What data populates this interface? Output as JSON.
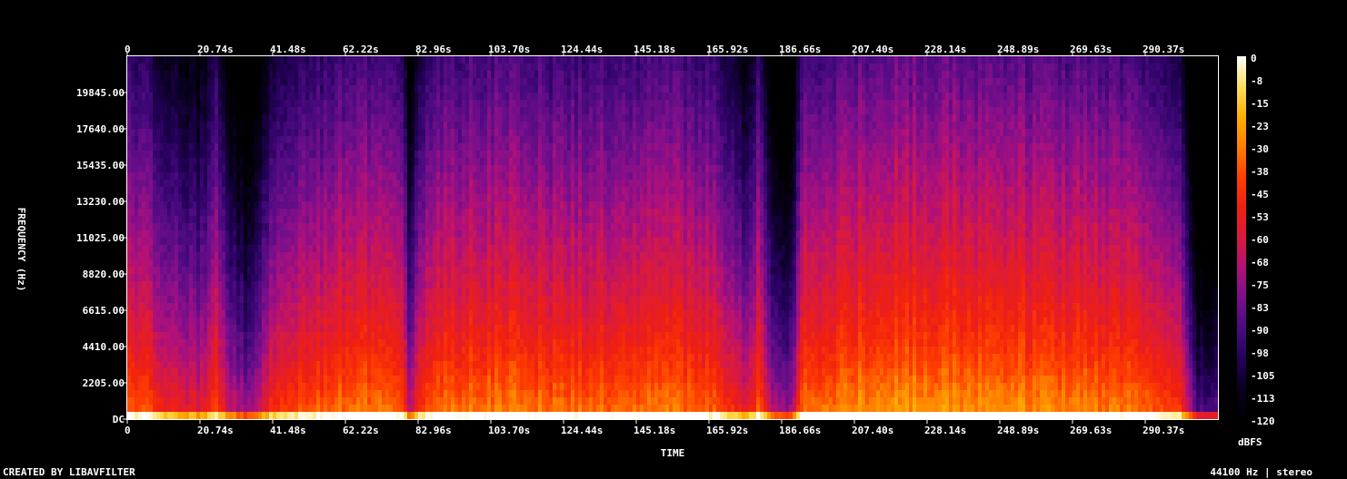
{
  "chart_data": {
    "type": "heatmap",
    "time_ticks": [
      "0",
      "20.74s",
      "41.48s",
      "62.22s",
      "82.96s",
      "103.70s",
      "124.44s",
      "145.18s",
      "165.92s",
      "186.66s",
      "207.40s",
      "228.14s",
      "248.89s",
      "269.63s",
      "290.37s"
    ],
    "freq_ticks": [
      "DC",
      "2205.00",
      "4410.00",
      "6615.00",
      "8820.00",
      "11025.00",
      "13230.00",
      "15435.00",
      "17640.00",
      "19845.00"
    ],
    "colorbar_ticks": [
      "0",
      "-8",
      "-15",
      "-23",
      "-30",
      "-38",
      "-45",
      "-53",
      "-60",
      "-68",
      "-75",
      "-83",
      "-90",
      "-98",
      "-105",
      "-113",
      "-120"
    ],
    "xlabel": "TIME",
    "ylabel": "FREQUENCY (Hz)",
    "colorbar_label": "dBFS",
    "colormap": [
      "#000000",
      "#0a0020",
      "#24005a",
      "#4a0a80",
      "#7a0f8c",
      "#b0107a",
      "#d81a40",
      "#f02010",
      "#ff4000",
      "#ff8000",
      "#ffb000",
      "#ffe060",
      "#ffffff"
    ],
    "intensity_profile": [
      {
        "t": 0,
        "level": 0.62
      },
      {
        "t": 5,
        "level": 0.6
      },
      {
        "t": 10,
        "level": 0.5
      },
      {
        "t": 20.74,
        "level": 0.45
      },
      {
        "t": 25,
        "level": 0.58
      },
      {
        "t": 28,
        "level": 0.42
      },
      {
        "t": 34,
        "level": 0.3
      },
      {
        "t": 41,
        "level": 0.55
      },
      {
        "t": 62.22,
        "level": 0.66
      },
      {
        "t": 78,
        "level": 0.64
      },
      {
        "t": 80,
        "level": 0.38
      },
      {
        "t": 85,
        "level": 0.64
      },
      {
        "t": 103.7,
        "level": 0.67
      },
      {
        "t": 124.44,
        "level": 0.64
      },
      {
        "t": 145.18,
        "level": 0.66
      },
      {
        "t": 165.92,
        "level": 0.64
      },
      {
        "t": 175,
        "level": 0.45
      },
      {
        "t": 180,
        "level": 0.62
      },
      {
        "t": 184,
        "level": 0.3
      },
      {
        "t": 189,
        "level": 0.3
      },
      {
        "t": 192,
        "level": 0.64
      },
      {
        "t": 207.4,
        "level": 0.7
      },
      {
        "t": 228.14,
        "level": 0.72
      },
      {
        "t": 248.89,
        "level": 0.7
      },
      {
        "t": 269.63,
        "level": 0.68
      },
      {
        "t": 290.37,
        "level": 0.64
      },
      {
        "t": 300,
        "level": 0.55
      },
      {
        "t": 305,
        "level": 0.15
      }
    ]
  },
  "footer": {
    "left": "CREATED BY LIBAVFILTER",
    "right": "44100 Hz | stereo"
  }
}
